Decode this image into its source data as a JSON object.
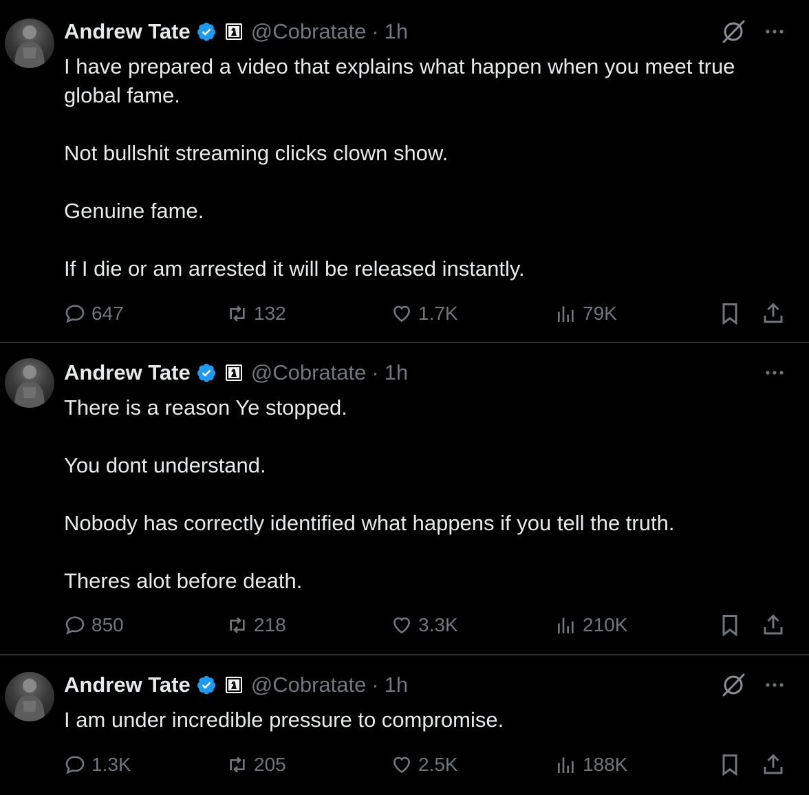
{
  "colors": {
    "background": "#000000",
    "text": "#e7e9ea",
    "muted": "#71767b",
    "verified_blue": "#1d9bf0",
    "divider": "#2f3336"
  },
  "tweets": [
    {
      "author": "Andrew Tate",
      "handle": "@Cobratate",
      "separator": "·",
      "time": "1h",
      "show_grok": true,
      "paragraphs": [
        "I have prepared a video that explains what happen when you meet true global fame.",
        "Not bullshit streaming clicks clown show.",
        "Genuine fame.",
        "If I die or am arrested it will be released instantly."
      ],
      "replies": "647",
      "reposts": "132",
      "likes": "1.7K",
      "views": "79K"
    },
    {
      "author": "Andrew Tate",
      "handle": "@Cobratate",
      "separator": "·",
      "time": "1h",
      "show_grok": false,
      "paragraphs": [
        "There is a reason Ye stopped.",
        "You dont understand.",
        "Nobody has correctly identified what happens if you tell the truth.",
        "Theres alot before death."
      ],
      "replies": "850",
      "reposts": "218",
      "likes": "3.3K",
      "views": "210K"
    },
    {
      "author": "Andrew Tate",
      "handle": "@Cobratate",
      "separator": "·",
      "time": "1h",
      "show_grok": true,
      "paragraphs": [
        "I am under incredible pressure to compromise."
      ],
      "replies": "1.3K",
      "reposts": "205",
      "likes": "2.5K",
      "views": "188K"
    }
  ],
  "icons": {
    "reply": "reply-icon",
    "repost": "repost-icon",
    "like": "heart-icon",
    "views": "views-icon",
    "bookmark": "bookmark-icon",
    "share": "share-icon",
    "grok": "grok-icon",
    "more": "more-icon",
    "verified": "verified-badge-icon",
    "affiliate": "affiliate-badge-icon"
  }
}
